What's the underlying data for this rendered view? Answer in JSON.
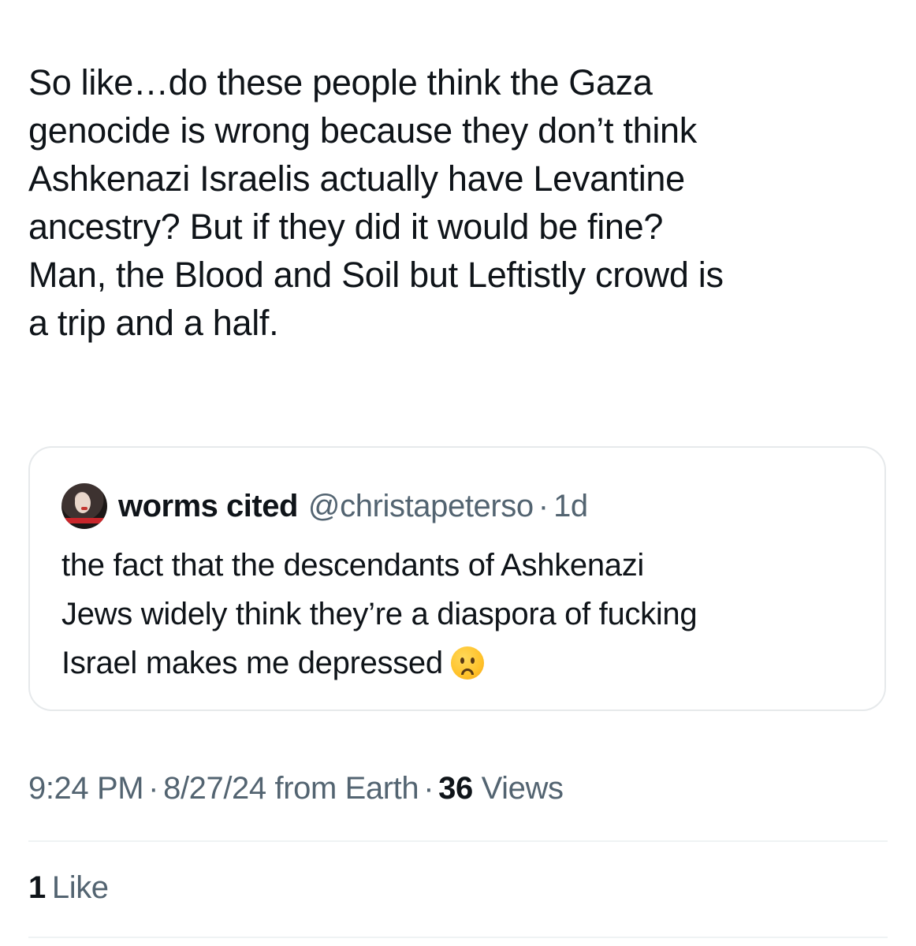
{
  "tweet": {
    "text": "So like…do these people think the Gaza\ngenocide is wrong because they don’t think\nAshkenazi Israelis actually have Levantine\nancestry? But if they did it would be fine?\nMan, the Blood and Soil but Leftistly crowd is\na trip and a half."
  },
  "quoted_tweet": {
    "display_name": "worms cited",
    "handle": "@christapeterso",
    "separator": "·",
    "time_ago": "1d",
    "text": "the fact that the descendants of Ashkenazi\nJews widely think they’re a diaspora of fucking\nIsrael makes me depressed",
    "emoji_icon": "frowning-face-emoji"
  },
  "meta": {
    "time": "9:24 PM",
    "separator": "·",
    "date": "8/27/24",
    "source": "from Earth",
    "views_count": "36",
    "views_label": "Views"
  },
  "likes": {
    "count": "1",
    "label": "Like"
  },
  "colors": {
    "text_primary": "#0f1419",
    "text_secondary": "#536471",
    "border": "#e6e9eb"
  }
}
